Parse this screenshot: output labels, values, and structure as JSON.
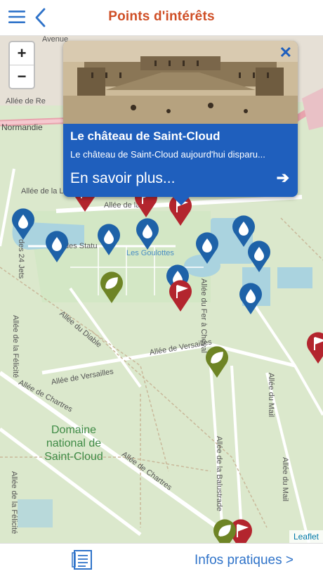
{
  "header": {
    "title": "Points d'intérêts",
    "menu_icon": "hamburger-menu-icon",
    "back_icon": "chevron-left-icon"
  },
  "zoom": {
    "in_label": "+",
    "out_label": "−"
  },
  "popup": {
    "title": "Le château de Saint-Cloud",
    "description": "Le château de Saint-Cloud aujourd'hui disparu...",
    "link_label": "En savoir plus...",
    "close_label": "✕",
    "arrow_label": "➔"
  },
  "map": {
    "labels": {
      "allee_de_la": "Allée de la",
      "normandie": "Normandie",
      "allee_re": "Allée de Re",
      "allee_de_la_l": "Allée de la L",
      "des_statu": "des Statu",
      "des_24_jets": "des 24 Jets",
      "les_goulottes": "Les Goulottes",
      "allee_du_diable": "Allée du Diable",
      "allee_de_la_felicite": "Allée de la Félicité",
      "allee_du_fer_a_cheval": "Allée du Fer à Cheval",
      "allee_de_versailles": "Allée de Versailles",
      "allee_de_versailles_2": "Allée de Versailles",
      "allee_de_chartres": "Allée de Chartres",
      "allee_de_chartres_2": "Allée de Chartres",
      "allee_de_la_felicite_2": "Allée de la Félicité",
      "allee_de_la_balustrade": "Allée de la Balustrade",
      "allee_du_mail": "Allée du Mail",
      "allee_du_mail_2": "Allée du Mail",
      "domaine": "Domaine national de Saint-Cloud",
      "avenue": "Avenue"
    },
    "attribution": "Leaflet",
    "colors": {
      "water_pin": "#1e62a8",
      "flag_pin": "#b3252e",
      "leaf_pin": "#6e8425"
    }
  },
  "footer": {
    "list_icon": "list-document-icon",
    "info_label": "Infos pratiques >"
  },
  "colors": {
    "accent": "#cf4e25",
    "link": "#2f73c9",
    "popup": "#1f5fbd"
  }
}
